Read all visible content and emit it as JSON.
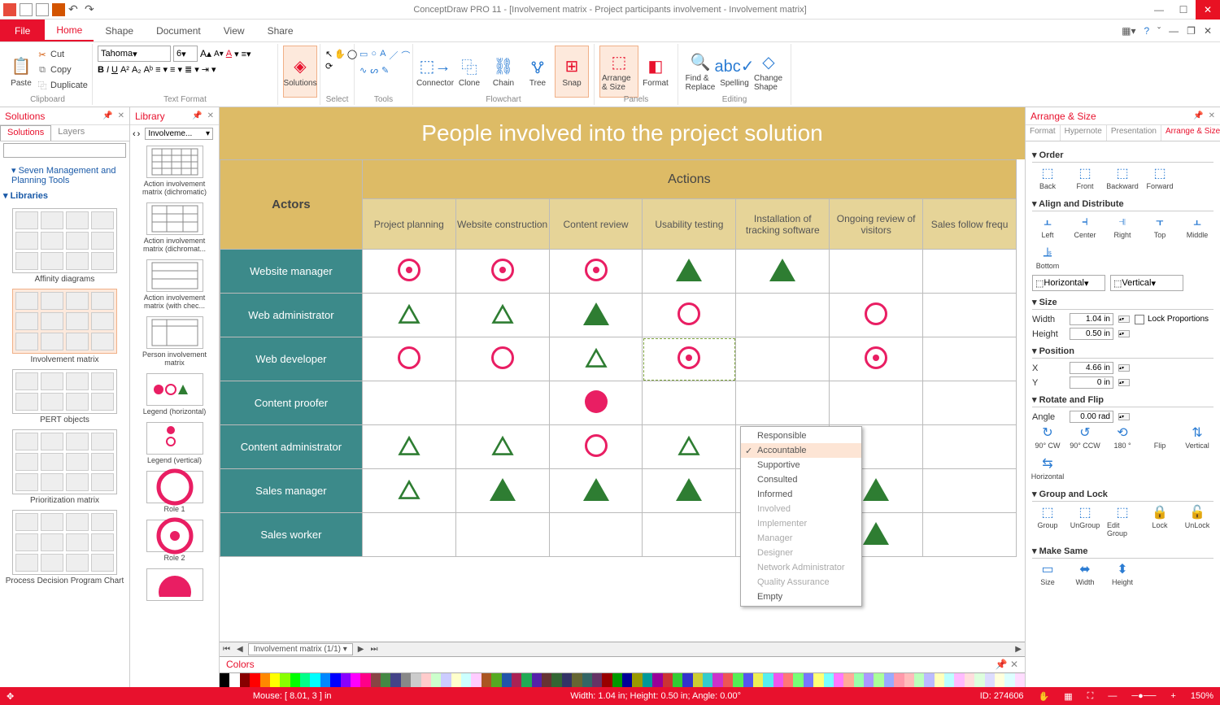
{
  "titlebar": {
    "title": "ConceptDraw PRO 11 - [Involvement matrix - Project participants involvement - Involvement matrix]"
  },
  "tabs": {
    "file": "File",
    "items": [
      "Home",
      "Shape",
      "Document",
      "View",
      "Share"
    ],
    "active": "Home"
  },
  "ribbon": {
    "clipboard": {
      "paste": "Paste",
      "cut": "Cut",
      "copy": "Copy",
      "duplicate": "Duplicate",
      "label": "Clipboard"
    },
    "textformat": {
      "font": "Tahoma",
      "size": "6",
      "label": "Text Format"
    },
    "solutions": "Solutions",
    "select": "Select",
    "tools": "Tools",
    "flowchart": {
      "connector": "Connector",
      "clone": "Clone",
      "chain": "Chain",
      "tree": "Tree",
      "snap": "Snap",
      "arrange": "Arrange & Size",
      "format": "Format",
      "label": "Flowchart",
      "panels": "Panels"
    },
    "editing": {
      "find": "Find & Replace",
      "spelling": "Spelling",
      "change": "Change Shape",
      "label": "Editing"
    }
  },
  "solutions": {
    "title": "Solutions",
    "tabs": [
      "Solutions",
      "Layers"
    ],
    "tree_item": "Seven Management and Planning Tools",
    "libraries_label": "Libraries",
    "thumbs": [
      "Affinity diagrams",
      "Involvement matrix",
      "PERT objects",
      "Prioritization matrix",
      "Process Decision Program Chart"
    ]
  },
  "library": {
    "title": "Library",
    "selected": "Involveme...",
    "items": [
      "Action involvement matrix (dichromatic)",
      "Action involvement matrix (dichromat...",
      "Action involvement matrix (with chec...",
      "Person involvement matrix",
      "Legend (horizontal)",
      "Legend (vertical)",
      "Role 1",
      "Role 2"
    ]
  },
  "matrix": {
    "title": "People involved into the project solution",
    "actors_label": "Actors",
    "actions_label": "Actions",
    "columns": [
      "Project planning",
      "Website construction",
      "Content review",
      "Usability testing",
      "Installation of tracking software",
      "Ongoing review of visitors",
      "Sales follow frequ"
    ],
    "rows": [
      "Website manager",
      "Web administrator",
      "Web developer",
      "Content proofer",
      "Content administrator",
      "Sales manager",
      "Sales worker"
    ],
    "cells": [
      [
        "cd",
        "cd",
        "cd",
        "tf",
        "tf",
        "",
        ""
      ],
      [
        "to",
        "to",
        "tf",
        "co",
        "",
        "co",
        ""
      ],
      [
        "co",
        "co",
        "to",
        "cd-sel",
        "",
        "cd",
        ""
      ],
      [
        "",
        "",
        "cf",
        "",
        "",
        "",
        ""
      ],
      [
        "to",
        "to",
        "co",
        "to",
        "",
        "",
        ""
      ],
      [
        "to",
        "tf",
        "tf",
        "tf",
        "",
        "tf",
        ""
      ],
      [
        "",
        "",
        "",
        "",
        "",
        "tf",
        ""
      ]
    ],
    "page_tab": "Involvement matrix (1/1)"
  },
  "context_menu": {
    "items": [
      "Responsible",
      "Accountable",
      "Supportive",
      "Consulted",
      "Informed",
      "Involved",
      "Implementer",
      "Manager",
      "Designer",
      "Network Administrator",
      "Quality Assurance",
      "Empty"
    ],
    "selected": "Accountable",
    "disabled": [
      "Involved",
      "Implementer",
      "Manager",
      "Designer",
      "Network Administrator",
      "Quality Assurance"
    ]
  },
  "rightpanel": {
    "title": "Arrange & Size",
    "tabs": [
      "Format",
      "Hypernote",
      "Presentation",
      "Arrange & Size"
    ],
    "order": {
      "title": "Order",
      "btns": [
        "Back",
        "Front",
        "Backward",
        "Forward"
      ]
    },
    "align": {
      "title": "Align and Distribute",
      "btns": [
        "Left",
        "Center",
        "Right",
        "Top",
        "Middle",
        "Bottom"
      ],
      "horiz": "Horizontal",
      "vert": "Vertical"
    },
    "size": {
      "title": "Size",
      "width_label": "Width",
      "width": "1.04 in",
      "height_label": "Height",
      "height": "0.50 in",
      "lock": "Lock Proportions"
    },
    "position": {
      "title": "Position",
      "x_label": "X",
      "x": "4.66 in",
      "y_label": "Y",
      "y": "0 in"
    },
    "rotate": {
      "title": "Rotate and Flip",
      "angle_label": "Angle",
      "angle": "0.00 rad",
      "btns": [
        "90° CW",
        "90° CCW",
        "180 °",
        "Flip",
        "Vertical",
        "Horizontal"
      ]
    },
    "grouplock": {
      "title": "Group and Lock",
      "btns": [
        "Group",
        "UnGroup",
        "Edit Group",
        "Lock",
        "UnLock"
      ]
    },
    "makesame": {
      "title": "Make Same",
      "btns": [
        "Size",
        "Width",
        "Height"
      ]
    }
  },
  "colors_panel": "Colors",
  "statusbar": {
    "mouse": "Mouse: [ 8.01, 3 ] in",
    "dims": "Width: 1.04 in;  Height: 0.50 in;  Angle: 0.00°",
    "id": "ID: 274606",
    "zoom": "150%"
  }
}
